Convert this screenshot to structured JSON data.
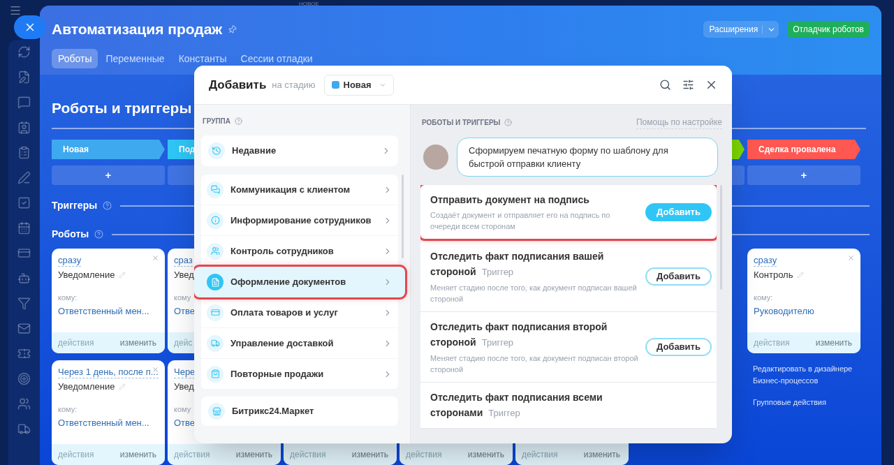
{
  "top_badge": "НОВОЕ",
  "header": {
    "title": "Автоматизация продаж",
    "extensions_button": "Расширения",
    "debugger_button": "Отладчик роботов"
  },
  "tabs": [
    {
      "label": "Роботы",
      "selected": true
    },
    {
      "label": "Переменные",
      "selected": false
    },
    {
      "label": "Константы",
      "selected": false
    },
    {
      "label": "Сессии отладки",
      "selected": false
    }
  ],
  "section_title": "Роботы и триггеры",
  "triggers_label": "Триггеры",
  "robots_label": "Роботы",
  "columns": [
    {
      "stage": {
        "label": "Новая",
        "color": "#3fa9f0"
      },
      "add": "+",
      "cards": [
        {
          "delay": "сразу",
          "title": "Уведомление",
          "to_label": "кому:",
          "to": "Ответственный мен...",
          "actions": "действия",
          "edit": "изменить"
        },
        {
          "delay": "Через 1 день, после п...",
          "title": "Уведомление",
          "to_label": "кому:",
          "to": "Ответственный мен...",
          "actions": "действия",
          "edit": "изменить"
        }
      ]
    },
    {
      "stage": {
        "label": "Под",
        "color": "#2fc6f6"
      },
      "cards": [
        {
          "delay": "сраз",
          "title": "Увед",
          "to_label": "кому",
          "to": "Отве",
          "actions": "дейс"
        },
        {
          "delay": "Чере",
          "title": "Увед",
          "to_label": "кому",
          "to": "Отве",
          "actions": "действия",
          "edit": "изменить"
        }
      ]
    },
    {
      "cards": [
        {
          "actions": "действия",
          "edit": "изменить"
        }
      ]
    },
    {
      "cards": [
        {
          "actions": "действия",
          "edit": "изменить"
        }
      ]
    },
    {
      "cards": [
        {
          "actions": "действия",
          "edit": "изменить"
        }
      ]
    },
    {
      "stage": {
        "color": "#7bd500"
      }
    },
    {
      "stage": {
        "label": "Сделка провалена",
        "color": "#ff5752"
      },
      "add": "+",
      "cards": [
        {
          "delay": "сразу",
          "title": "Контроль",
          "to_label": "кому:",
          "to": "Руководителю",
          "actions": "действия",
          "edit": "изменить"
        }
      ],
      "links": [
        "Редактировать в дизайнере Бизнес-процессов",
        "Групповые действия"
      ]
    }
  ],
  "modal": {
    "title": "Добавить",
    "stage_prefix": "на стадию",
    "stage": {
      "label": "Новая",
      "color": "#3fa9f0"
    },
    "groups_label": "ГРУППА",
    "recent": {
      "label": "Недавние"
    },
    "groups": [
      {
        "label": "Коммуникация с клиентом",
        "selected": false,
        "highlighted": false
      },
      {
        "label": "Информирование сотрудников",
        "selected": false,
        "highlighted": false
      },
      {
        "label": "Контроль сотрудников",
        "selected": false,
        "highlighted": false
      },
      {
        "label": "Оформление документов",
        "selected": true,
        "highlighted": true
      },
      {
        "label": "Оплата товаров и услуг",
        "selected": false,
        "highlighted": false
      },
      {
        "label": "Управление доставкой",
        "selected": false,
        "highlighted": false
      },
      {
        "label": "Повторные продажи",
        "selected": false,
        "highlighted": false
      }
    ],
    "market": {
      "label": "Битрикс24.Маркет"
    },
    "robots_label": "РОБОТЫ И ТРИГГЕРЫ",
    "help_link": "Помощь по настройке",
    "advisor_text": "Сформируем печатную форму по шаблону для быстрой отправки клиенту",
    "robots": [
      {
        "title": "Отправить документ на подпись",
        "description": "Создаёт документ и отправляет его на подпись по очереди всем сторонам",
        "button": "Добавить",
        "highlighted": true
      },
      {
        "title": "Отследить факт подписания вашей стороной",
        "tag": "Триггер",
        "description": "Меняет стадию после того, как документ подписан вашей стороной",
        "button": "Добавить",
        "highlighted": false
      },
      {
        "title": "Отследить факт подписания второй стороной",
        "tag": "Триггер",
        "description": "Меняет стадию после того, как документ подписан второй стороной",
        "button": "Добавить",
        "highlighted": false
      },
      {
        "title": "Отследить факт подписания всеми сторонами",
        "tag": "Триггер",
        "highlighted": false
      }
    ]
  }
}
